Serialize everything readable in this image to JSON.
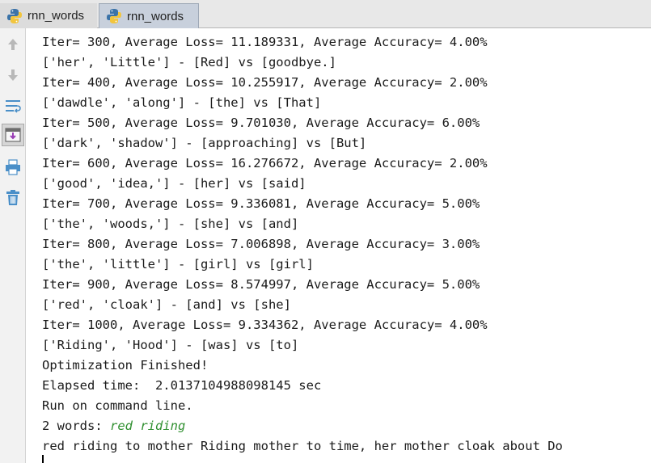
{
  "tabs": [
    {
      "label": "rnn_words",
      "active": false
    },
    {
      "label": "rnn_words",
      "active": true
    }
  ],
  "toolbar": {
    "icons": [
      "arrow-up-icon",
      "arrow-down-icon",
      "soft-wrap-icon",
      "scroll-to-end-icon",
      "print-icon",
      "trash-icon"
    ],
    "selected": "scroll-to-end-icon"
  },
  "console": {
    "lines": [
      "Iter= 300, Average Loss= 11.189331, Average Accuracy= 4.00%",
      "['her', 'Little'] - [Red] vs [goodbye.]",
      "Iter= 400, Average Loss= 10.255917, Average Accuracy= 2.00%",
      "['dawdle', 'along'] - [the] vs [That]",
      "Iter= 500, Average Loss= 9.701030, Average Accuracy= 6.00%",
      "['dark', 'shadow'] - [approaching] vs [But]",
      "Iter= 600, Average Loss= 16.276672, Average Accuracy= 2.00%",
      "['good', 'idea,'] - [her] vs [said]",
      "Iter= 700, Average Loss= 9.336081, Average Accuracy= 5.00%",
      "['the', 'woods,'] - [she] vs [and]",
      "Iter= 800, Average Loss= 7.006898, Average Accuracy= 3.00%",
      "['the', 'little'] - [girl] vs [girl]",
      "Iter= 900, Average Loss= 8.574997, Average Accuracy= 5.00%",
      "['red', 'cloak'] - [and] vs [she]",
      "Iter= 1000, Average Loss= 9.334362, Average Accuracy= 4.00%",
      "['Riding', 'Hood'] - [was] vs [to]",
      "Optimization Finished!",
      "Elapsed time:  2.0137104988098145 sec",
      "Run on command line."
    ],
    "prompt_label": "2 words: ",
    "user_input": "red riding",
    "generated_output": "red riding to mother Riding mother to time, her mother cloak about Do"
  },
  "colors": {
    "input_text": "#2f8f2f",
    "active_tab": "#c8d0dc",
    "toolbar_icon": "#4a8fc8"
  }
}
